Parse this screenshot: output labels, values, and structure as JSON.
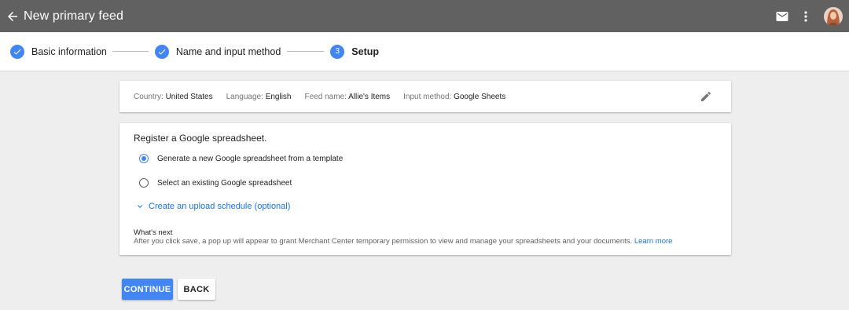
{
  "app_bar": {
    "title": "New primary feed",
    "back_icon": "arrow-back-icon",
    "mail_icon": "mail-icon",
    "more_icon": "more-vert-icon",
    "avatar": "user-avatar"
  },
  "stepper": {
    "steps": [
      {
        "label": "Basic information",
        "state": "complete",
        "icon": "check-icon"
      },
      {
        "label": "Name and input method",
        "state": "complete",
        "icon": "check-icon"
      },
      {
        "label": "Setup",
        "state": "active",
        "number": "3"
      }
    ]
  },
  "summary": {
    "country_key": "Country:",
    "country_value": "United States",
    "language_key": "Language:",
    "language_value": "English",
    "feed_name_key": "Feed name:",
    "feed_name_value": "Allie's Items",
    "input_method_key": "Input method:",
    "input_method_value": "Google Sheets",
    "edit_icon": "pencil-icon"
  },
  "register": {
    "heading": "Register a Google spreadsheet.",
    "options": [
      {
        "label": "Generate a new Google spreadsheet from a template",
        "selected": true
      },
      {
        "label": "Select an existing Google spreadsheet",
        "selected": false
      }
    ],
    "upload_schedule_link": "Create an upload schedule (optional)",
    "whats_next_title": "What's next",
    "whats_next_text": "After you click save, a pop up will appear to grant Merchant Center temporary permission to view and manage your spreadsheets and your documents.",
    "learn_more": "Learn more"
  },
  "actions": {
    "continue_label": "CONTINUE",
    "back_label": "BACK"
  },
  "colors": {
    "accent": "#4285f4",
    "app_bar": "#616161",
    "link": "#1a73e8"
  }
}
